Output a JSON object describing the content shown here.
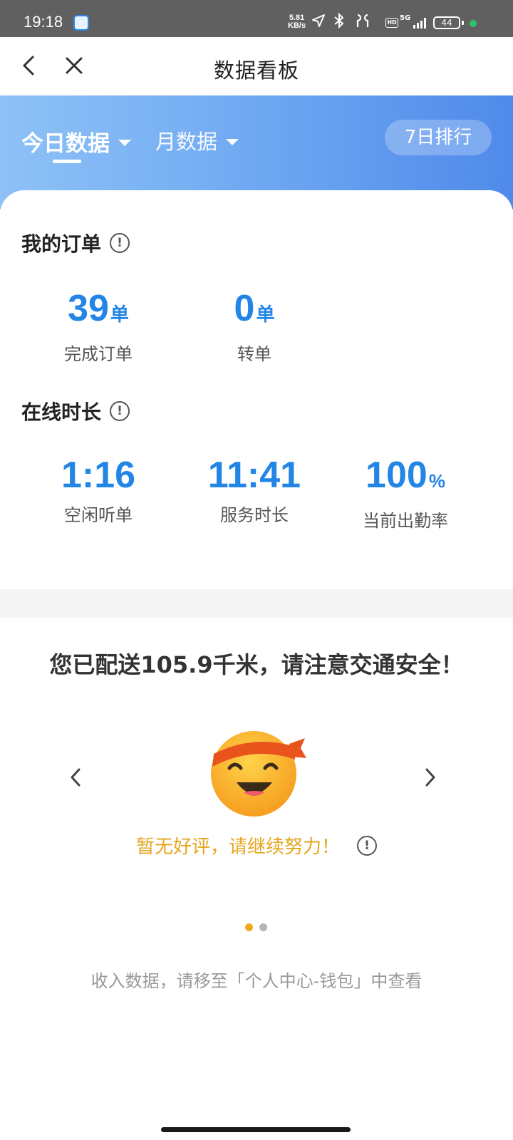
{
  "status_bar": {
    "time": "19:18",
    "net_speed_value": "5.81",
    "net_speed_unit": "KB/s",
    "hd": "HD",
    "network": "5G",
    "battery": "44",
    "icons": [
      "app-icon",
      "location-arrow-icon",
      "bluetooth-icon",
      "earbuds-icon",
      "signal-icon",
      "battery-icon"
    ]
  },
  "nav": {
    "title": "数据看板"
  },
  "tabs": {
    "today": "今日数据",
    "month": "月数据",
    "rank_button": "7日排行"
  },
  "orders": {
    "title": "我的订单",
    "completed_value": "39",
    "completed_unit": "单",
    "completed_label": "完成订单",
    "transfer_value": "0",
    "transfer_unit": "单",
    "transfer_label": "转单"
  },
  "online": {
    "title": "在线时长",
    "idle_value": "1:16",
    "idle_label": "空闲听单",
    "service_value": "11:41",
    "service_label": "服务时长",
    "attendance_value": "100",
    "attendance_unit": "%",
    "attendance_label": "当前出勤率"
  },
  "info_mark": "!",
  "delivery": {
    "distance_text": "您已配送105.9千米，请注意交通安全！",
    "praise_text": "暂无好评，请继续努力！",
    "carousel_total": 2,
    "carousel_active": 1
  },
  "footer": {
    "note": "收入数据，请移至「个人中心-钱包」中查看"
  },
  "colors": {
    "accent_blue": "#2385e6",
    "praise_orange": "#e5a51e",
    "hero_start": "#8ec1f6",
    "hero_end": "#4f8aea",
    "dot_active": "#f0a91c",
    "dot_inactive": "#b5b5b5"
  }
}
